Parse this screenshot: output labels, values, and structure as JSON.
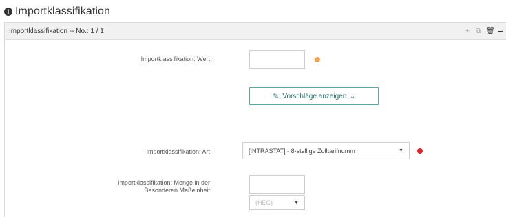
{
  "section": {
    "title": "Importklassifikation",
    "icon": "info-circle-icon"
  },
  "panel": {
    "header_title": "Importklassifikation -- No.: 1 / 1",
    "tools": [
      "add-icon",
      "copy-icon",
      "delete-icon",
      "collapse-icon"
    ]
  },
  "fields": {
    "wert": {
      "label": "Importklassifikation: Wert",
      "value": "",
      "indicator_color": "#f0a050"
    },
    "suggest_button": {
      "label": "Vorschläge anzeigen"
    },
    "art": {
      "label": "Importklassifikation: Art",
      "value": "[INTRASTAT] - 8-stellige Zolltarifnumm",
      "indicator_color": "#e0242b"
    },
    "menge": {
      "label_line1": "Importklassifikation: Menge in der",
      "label_line2": "Besonderen Maßeinheit",
      "value": "",
      "unit_placeholder": "(HEC)"
    }
  },
  "colors": {
    "accent": "#5ea6a0",
    "header_bg": "#f1f1f1"
  }
}
